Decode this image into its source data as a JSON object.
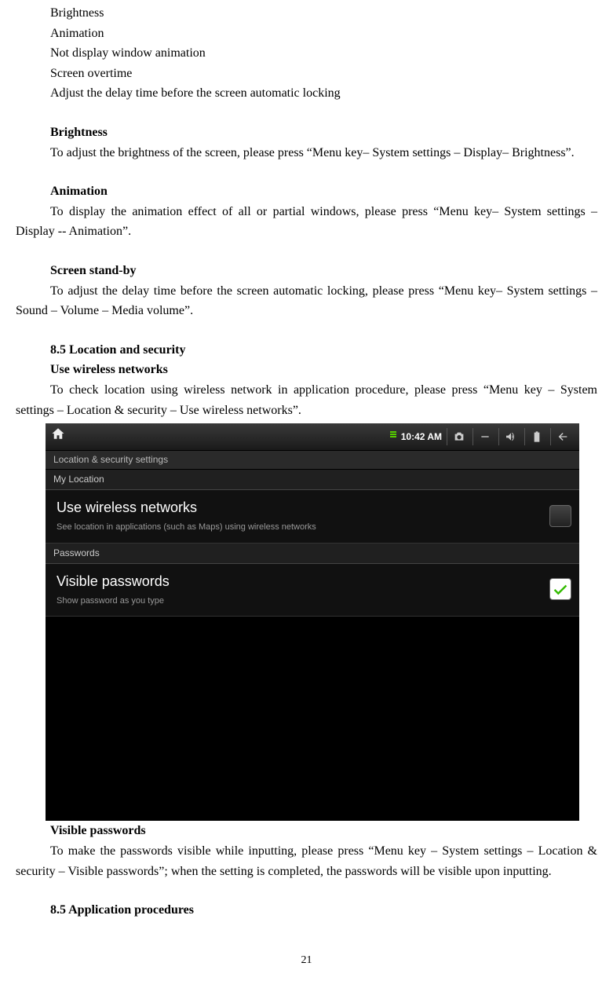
{
  "body": {
    "l1": "Brightness",
    "l2": "Animation",
    "l3": "Not display window animation",
    "l4": "Screen overtime",
    "l5": "Adjust the delay time before the screen automatic locking",
    "h_brightness": "Brightness",
    "p_brightness": "To adjust the brightness of the screen, please press “Menu key– System settings – Display– Brightness”.",
    "h_animation": "Animation",
    "p_animation": "To display the animation effect of all or partial windows, please press “Menu key– System settings – Display -- Animation”.",
    "h_standby": "Screen stand-by",
    "p_standby": "To adjust the delay time before the screen automatic locking, please press “Menu key– System settings – Sound – Volume – Media volume”.",
    "h_loc": "8.5 Location and security",
    "h_wireless": "Use wireless networks",
    "p_wireless": "To check location using wireless network in application procedure, please press “Menu key – System settings – Location & security – Use wireless networks”.",
    "h_visible": "Visible passwords",
    "p_visible": "To make the passwords visible while inputting, please press “Menu key – System settings – Location & security – Visible passwords”; when the setting is completed, the passwords will be visible upon inputting.",
    "h_app": "8.5 Application procedures"
  },
  "device": {
    "time": "10:42 AM",
    "screen_title": "Location & security settings",
    "cat1": "My Location",
    "row1_title": "Use wireless networks",
    "row1_sub": "See location in applications (such as Maps) using wireless networks",
    "cat2": "Passwords",
    "row2_title": "Visible passwords",
    "row2_sub": "Show password as you type"
  },
  "page_number": "21"
}
